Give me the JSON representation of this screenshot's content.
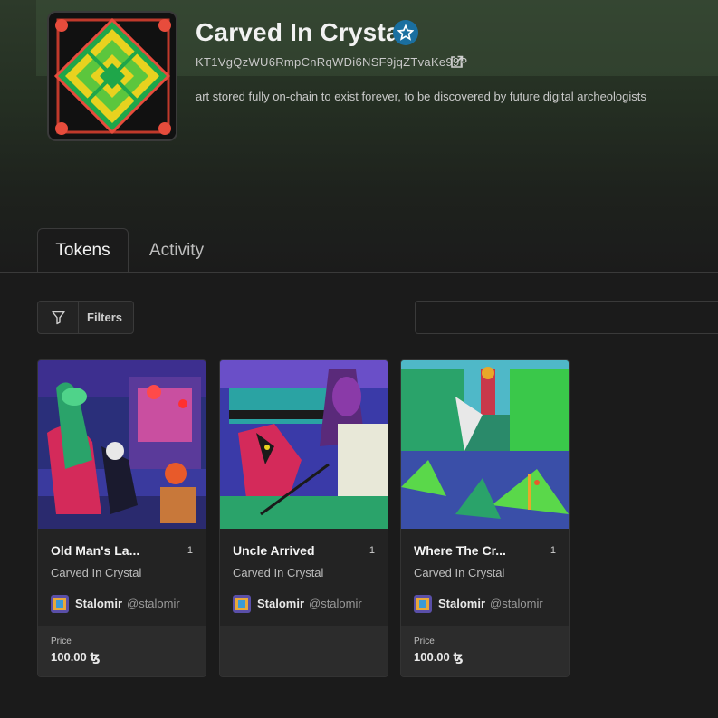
{
  "collection": {
    "title": "Carved In Crystal",
    "address": "KT1VgQzWU6RmpCnRqWDi6NSF9jqZTvaKe99P",
    "description": "art stored fully on-chain to exist forever, to be discovered by future digital archeologists"
  },
  "tabs": [
    {
      "label": "Tokens",
      "active": true
    },
    {
      "label": "Activity",
      "active": false
    }
  ],
  "toolbar": {
    "filters_label": "Filters",
    "search_value": ""
  },
  "tokens": [
    {
      "name": "Old Man's La...",
      "edition": "1",
      "collection": "Carved In Crystal",
      "creator": "Stalomir",
      "handle": "@stalomir",
      "price_label": "Price",
      "price": "100.00 ꜩ"
    },
    {
      "name": "Uncle Arrived",
      "edition": "1",
      "collection": "Carved In Crystal",
      "creator": "Stalomir",
      "handle": "@stalomir"
    },
    {
      "name": "Where The Cr...",
      "edition": "1",
      "collection": "Carved In Crystal",
      "creator": "Stalomir",
      "handle": "@stalomir",
      "price_label": "Price",
      "price": "100.00 ꜩ"
    }
  ],
  "colors": {
    "background": "#1b1b1b",
    "banner": "#2d3a2a",
    "verified_badge": "#1a6fa0",
    "card": "#232323",
    "price_box": "#2c2c2c"
  },
  "icons": [
    "verified-badge-icon",
    "external-link-icon",
    "filter-funnel-icon"
  ]
}
